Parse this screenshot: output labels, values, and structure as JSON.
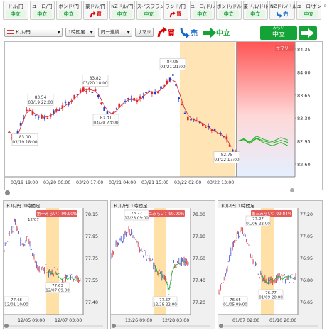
{
  "tiles": [
    {
      "name": "ドル/円",
      "signal": "中立",
      "type": "neutral"
    },
    {
      "name": "ユーロ/円",
      "signal": "中立",
      "type": "neutral"
    },
    {
      "name": "ポンド/円",
      "signal": "中立",
      "type": "neutral"
    },
    {
      "name": "豪ドル/円",
      "signal": "買",
      "type": "buy"
    },
    {
      "name": "NZドル/円",
      "signal": "中立",
      "type": "neutral"
    },
    {
      "name": "スイスフラン/円",
      "signal": "中立",
      "type": "neutral"
    },
    {
      "name": "ランド/円",
      "signal": "買",
      "type": "buy"
    },
    {
      "name": "ユーロ/ドル",
      "signal": "中立",
      "type": "neutral"
    },
    {
      "name": "ポンド/ドル",
      "signal": "中立",
      "type": "neutral"
    },
    {
      "name": "豪ドル/ドル",
      "signal": "中立",
      "type": "neutral"
    },
    {
      "name": "NZドル/ドル",
      "signal": "売",
      "type": "sell"
    },
    {
      "name": "ユーロ/ポンド",
      "signal": "中立",
      "type": "neutral"
    }
  ],
  "toolbar": {
    "pair": "ドル/円",
    "timeframe": "1時間足",
    "match_mode": "同一連続",
    "summary_button": "サマリ",
    "buy_label": "買",
    "sell_label": "売",
    "neutral_label": "中立",
    "forecast_small": "みらい",
    "forecast_big": "中立"
  },
  "main_chart": {
    "summary_tag": "サマリー",
    "y_ticks": [
      "84.35",
      "84.00",
      "83.65",
      "83.30",
      "82.95",
      "82.60"
    ],
    "x_ticks": [
      "03/19 19:00",
      "03/20 06:00",
      "03/20 17:00",
      "03/21 04:00",
      "03/21 15:00",
      "03/22 02:00",
      "03/22 13:00"
    ],
    "annotations": [
      {
        "price": "84.08",
        "time": "03/21 21:00"
      },
      {
        "price": "83.82",
        "time": "03/20 18:00"
      },
      {
        "price": "83.54",
        "time": "03/19 22:00"
      },
      {
        "price": "83.31",
        "time": "03/20 23:00"
      },
      {
        "price": "83.00",
        "time": "03/19 18:00"
      },
      {
        "price": "82.75",
        "time": "03/22 17:00"
      }
    ]
  },
  "panels": [
    {
      "pair": "ドル/円",
      "timeframe": "1時間足",
      "match": "第一みらい：99.90%",
      "y_ticks": [
        "78.15",
        "77.95",
        "77.75",
        "77.55",
        "77.40"
      ],
      "x_ticks": [
        "12/05 09:00",
        "12/07 03:00"
      ],
      "ann_high": {
        "price": "77.63",
        "time": "12/07 09:00"
      },
      "ann_low": {
        "price": "77.48",
        "time": "12/01 10:00"
      },
      "ann_top": "12/07"
    },
    {
      "pair": "ドル/円",
      "timeframe": "1時間足",
      "match": "第二みらい：99.90%",
      "y_ticks": [
        "78.00",
        "77.80",
        "77.60",
        "77.40",
        "77.20"
      ],
      "x_ticks": [
        "12/26 09:00",
        "12/28 03:00"
      ],
      "ann_high": {
        "price": "78.22",
        "time": "12/23 09:00"
      },
      "ann_low": {
        "price": "77.57",
        "time": "12/28 22:00"
      },
      "ann_top": ""
    },
    {
      "pair": "ドル/円",
      "timeframe": "1時間足",
      "match": "第三みらい：99.84%",
      "y_ticks": [
        "77.20",
        "77.05",
        "76.95",
        "76.80",
        "76.65"
      ],
      "x_ticks": [
        "01/07 02:00",
        "01/10 20:00"
      ],
      "ann_high": {
        "price": "77.27",
        "time": "01/06 22:00"
      },
      "ann_low": {
        "price": "76.77",
        "time": "01/09 20:00"
      },
      "ann_low2": {
        "price": "76.65",
        "time": "01/05 09:00"
      },
      "ann_top": ""
    }
  ]
}
